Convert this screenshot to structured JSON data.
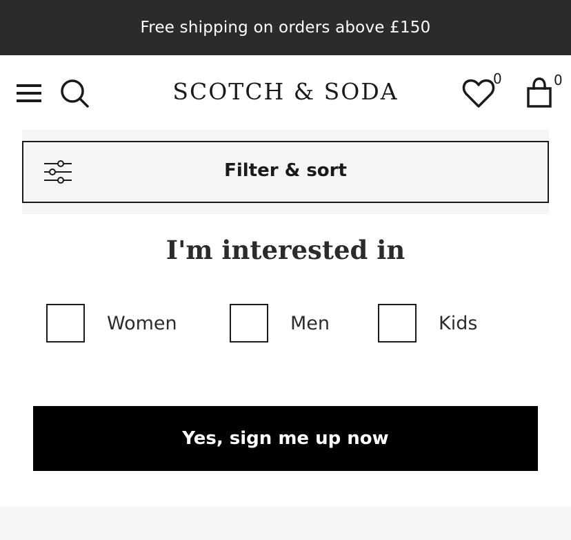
{
  "promo": {
    "text": "Free shipping on orders above £150"
  },
  "header": {
    "logo": "SCOTCH & SODA",
    "icons": {
      "menu": "hamburger-menu-icon",
      "search": "search-icon",
      "wishlist": "heart-icon",
      "cart": "shopping-bag-icon"
    },
    "wishlist_count": "0",
    "cart_count": "0"
  },
  "filter": {
    "label": "Filter & sort",
    "icon": "sliders-icon"
  },
  "interest": {
    "title": "I'm interested in",
    "options": [
      {
        "label": "Women",
        "checked": false
      },
      {
        "label": "Men",
        "checked": false
      },
      {
        "label": "Kids",
        "checked": false
      }
    ]
  },
  "signup": {
    "button_label": "Yes, sign me up now"
  },
  "colors": {
    "promo_bg": "#2b2b2b",
    "filter_bg": "#f6f5f3",
    "button_bg": "#000000",
    "text": "#1a1a1a"
  }
}
